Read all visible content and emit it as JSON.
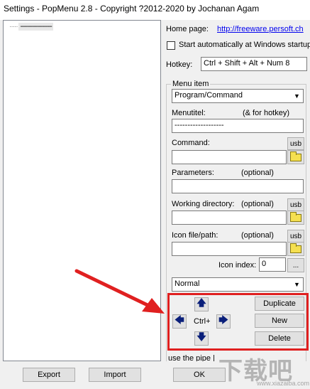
{
  "window": {
    "title": "Settings - PopMenu 2.8 - Copyright ?2012-2020 by Jochanan Agam"
  },
  "tree": {
    "items": [
      {
        "dots": "·····",
        "label": "-------------------"
      }
    ]
  },
  "settings": {
    "homepage_label": "Home page:",
    "homepage_link": "http://freeware.persoft.ch",
    "startup_label": "Start automatically at Windows startup",
    "startup_checked": false,
    "hotkey_label": "Hotkey:",
    "hotkey_value": "Ctrl + Shift + Alt + Num 8"
  },
  "menu_item": {
    "group_title": "Menu item",
    "type_value": "Program/Command",
    "menutitel_label": "Menutitel:",
    "menutitel_hint": "(& for hotkey)",
    "menutitel_value": "-------------------",
    "command_label": "Command:",
    "command_value": "",
    "parameters_label": "Parameters:",
    "parameters_hint": "(optional)",
    "parameters_value": "",
    "workdir_label": "Working directory:",
    "workdir_hint": "(optional)",
    "workdir_value": "",
    "iconfile_label": "Icon file/path:",
    "iconfile_hint": "(optional)",
    "iconfile_value": "",
    "iconindex_label": "Icon index:",
    "iconindex_value": "0",
    "usb_label": "usb",
    "browse_label": "...",
    "window_state_value": "Normal"
  },
  "reorder": {
    "up_glyph": "🡅",
    "left_glyph": "🡄",
    "right_glyph": "🡆",
    "down_glyph": "🡇",
    "center_label": "Ctrl+",
    "duplicate_label": "Duplicate",
    "new_label": "New",
    "delete_label": "Delete"
  },
  "footer": {
    "pipe_hint": "use the pipe |",
    "export_label": "Export",
    "import_label": "Import",
    "ok_label": "OK"
  },
  "watermark": {
    "big_text": "下载吧",
    "small_text": "www.xiazaiba.com"
  },
  "colors": {
    "highlight_border": "#e02020",
    "link": "#0000ee",
    "arrow_blue": "#0a1f7a"
  }
}
